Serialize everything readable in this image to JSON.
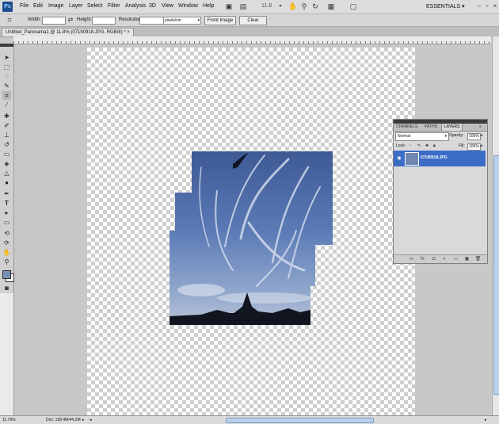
{
  "app": {
    "logo": "Ps",
    "workspace": "ESSENTIALS"
  },
  "menus": [
    "File",
    "Edit",
    "Image",
    "Layer",
    "Select",
    "Filter",
    "Analysis",
    "3D",
    "View",
    "Window",
    "Help"
  ],
  "toolbar": {
    "zoom": "11.8"
  },
  "options": {
    "width_label": "Width:",
    "height_label": "Height:",
    "resolution_label": "Resolution:",
    "width_value": "",
    "height_value": "",
    "resolution_value": "",
    "units": "pixels/cm",
    "front_image": "Front Image",
    "clear": "Clear"
  },
  "document": {
    "tab": "Untitled_Panorama1 @ 11.8% (07190918.JPG, RGB/8) *",
    "close": "×"
  },
  "status": {
    "zoom": "11.76%",
    "doc": "Doc: 158.4M/44.2M"
  },
  "layers_panel": {
    "tabs": [
      "CHANNELS",
      "PATHS",
      "LAYERS"
    ],
    "active_tab": "LAYERS",
    "blend_mode": "Normal",
    "opacity_label": "Opacity:",
    "opacity": "100%",
    "lock_label": "Lock:",
    "fill_label": "Fill:",
    "fill": "100%",
    "layer_name": "07190918.JPG"
  },
  "colors": {
    "accent": "#3c6dc6",
    "foreground": "#7890b6",
    "background": "#ffffff"
  }
}
